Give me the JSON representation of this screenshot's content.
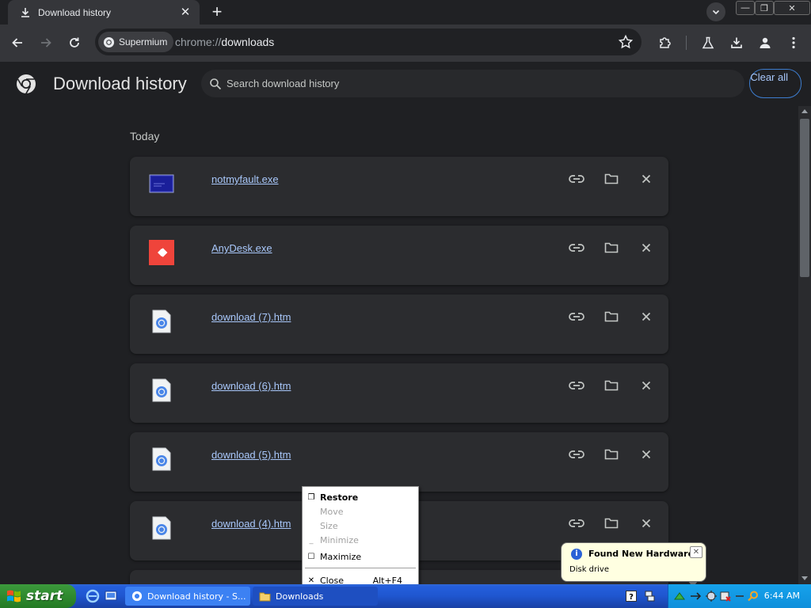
{
  "tab": {
    "title": "Download history",
    "close_glyph": "✕",
    "new_tab_glyph": "+"
  },
  "window_controls": {
    "minimize": "—",
    "restore": "❐",
    "close": "✕"
  },
  "omnibox": {
    "chip_label": "Supermium",
    "url_scheme": "chrome://",
    "url_path": "downloads"
  },
  "page": {
    "title": "Download history",
    "search_placeholder": "Search download history",
    "clear_all": "Clear all",
    "section_today": "Today"
  },
  "downloads": [
    {
      "name": "notmyfault.exe",
      "icon": "notmyfault-icon"
    },
    {
      "name": "AnyDesk.exe",
      "icon": "anydesk-icon"
    },
    {
      "name": "download (7).htm",
      "icon": "chrome-file-icon"
    },
    {
      "name": "download (6).htm",
      "icon": "chrome-file-icon"
    },
    {
      "name": "download (5).htm",
      "icon": "chrome-file-icon"
    },
    {
      "name": "download (4).htm",
      "icon": "chrome-file-icon"
    }
  ],
  "context_menu": {
    "restore": "Restore",
    "move": "Move",
    "size": "Size",
    "minimize": "Minimize",
    "maximize": "Maximize",
    "close": "Close",
    "close_shortcut": "Alt+F4"
  },
  "balloon": {
    "title": "Found New Hardware",
    "text": "Disk drive",
    "close_glyph": "✕"
  },
  "taskbar": {
    "start_label": "start",
    "tasks": [
      {
        "label": "Download history - S..."
      },
      {
        "label": "Downloads"
      }
    ],
    "clock": "6:44 AM"
  },
  "colors": {
    "accent": "#a8c7fa",
    "page_bg": "#1f2023",
    "card_bg": "#2b2c2f",
    "taskbar_blue": "#245edc",
    "start_green": "#2f8a2f"
  }
}
